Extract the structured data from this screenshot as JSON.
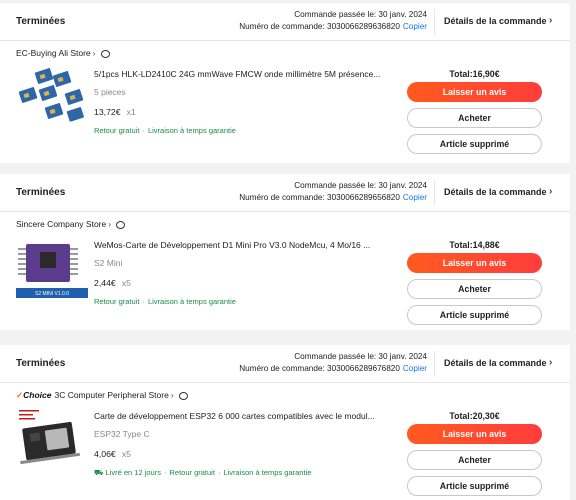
{
  "orders": [
    {
      "status": "Terminées",
      "placed": "Commande passée le: 30 janv. 2024",
      "number": "Numéro de commande: 3030066289636820",
      "copy": "Copier",
      "details": "Détails de la commande",
      "store": "EC-Buying Ali Store",
      "choice": "",
      "title": "5/1pcs HLK-LD2410C 24G mmWave FMCW onde millimètre 5M présence...",
      "variant": "5 pieces",
      "price": "13,72€",
      "qty": "x1",
      "badges": [
        "Retour gratuit",
        "Livraison à temps garantie"
      ],
      "total": "Total:16,90€",
      "buttons": {
        "review": "Laisser un avis",
        "buy": "Acheter",
        "deleted": "Article supprimé"
      }
    },
    {
      "status": "Terminées",
      "placed": "Commande passée le: 30 janv. 2024",
      "number": "Numéro de commande: 3030066289656820",
      "copy": "Copier",
      "details": "Détails de la commande",
      "store": "Sincere Company Store",
      "choice": "",
      "title": "WeMos-Carte de Développement D1 Mini Pro V3.0 NodeMcu, 4 Mo/16 ...",
      "variant": "S2 Mini",
      "price": "2,44€",
      "qty": "x5",
      "badges": [
        "Retour gratuit",
        "Livraison à temps garantie"
      ],
      "thumb_caption": "S2 MINI V1.0.0",
      "total": "Total:14,88€",
      "buttons": {
        "review": "Laisser un avis",
        "buy": "Acheter",
        "deleted": "Article supprimé"
      }
    },
    {
      "status": "Terminées",
      "placed": "Commande passée le: 30 janv. 2024",
      "number": "Numéro de commande: 3030066289676820",
      "copy": "Copier",
      "details": "Détails de la commande",
      "store": "3C Computer Peripheral Store",
      "choice": "Choice",
      "title": "Carte de développement ESP32 6 000 cartes compatibles avec le modul...",
      "variant": "ESP32 Type C",
      "price": "4,06€",
      "qty": "x5",
      "badges": [
        "Livré en 12 jours",
        "Retour gratuit",
        "Livraison à temps garantie"
      ],
      "total": "Total:20,30€",
      "buttons": {
        "review": "Laisser un avis",
        "buy": "Acheter",
        "deleted": "Article supprimé"
      }
    }
  ],
  "colors": {
    "accent": "#ff4b2b",
    "green": "#1a8a4a",
    "link": "#1a73e8"
  }
}
